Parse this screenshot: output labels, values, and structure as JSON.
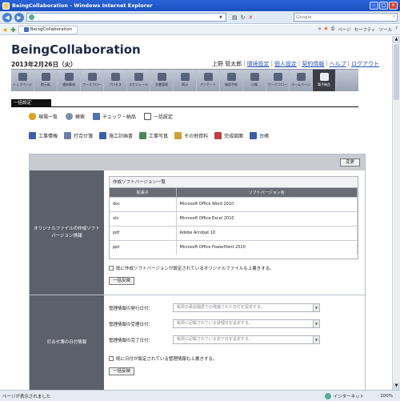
{
  "window": {
    "title": "BeingCollaboration - Windows Internet Explorer",
    "tab_title": "BeingCollaboration",
    "search_placeholder": "Google",
    "fav_tools": [
      "ページ",
      "セーフティ",
      "ツール"
    ]
  },
  "header": {
    "brand": "BeingCollaboration",
    "date": "2013年2月26日（火）",
    "user": "上野 管太郎",
    "links": [
      "環境設定",
      "個人設定",
      "契約情報",
      "ヘルプ",
      "ログアウト"
    ]
  },
  "nav": [
    {
      "label": "トップページ",
      "active": false
    },
    {
      "label": "掲示板",
      "active": false
    },
    {
      "label": "通知事項",
      "active": false
    },
    {
      "label": "ワークフロー",
      "active": false
    },
    {
      "label": "プロセス",
      "active": false
    },
    {
      "label": "スケジュール",
      "active": false
    },
    {
      "label": "文書管理",
      "active": false
    },
    {
      "label": "掲示",
      "active": false
    },
    {
      "label": "アンケート",
      "active": false
    },
    {
      "label": "施設予約",
      "active": false
    },
    {
      "label": "日報",
      "active": false
    },
    {
      "label": "ワークフロー",
      "active": false
    },
    {
      "label": "ホームページ",
      "active": false
    },
    {
      "label": "電子納品",
      "active": true
    }
  ],
  "section_title": "一括設定",
  "quick_links_row1": [
    "現場一覧",
    "検索",
    "チェック・納品",
    "一括設定"
  ],
  "quick_links_row2": [
    "工事情報",
    "打合せ簿",
    "施工計画書",
    "工事写真",
    "その他資料",
    "完成図面",
    "台帳"
  ],
  "panel": {
    "change_button": "変更",
    "section1": {
      "heading": "オリジナルファイルの作成ソフトバージョン情報",
      "table_title": "作成ソフトバージョン一覧",
      "columns": [
        "拡張子",
        "ソフトバージョン名"
      ],
      "rows": [
        [
          "doc",
          "Microsoft Office Word 2010"
        ],
        [
          "xls",
          "Microsoft Office Excel 2010"
        ],
        [
          "pdf",
          "Adobe Acrobat 10"
        ],
        [
          "ppt",
          "Microsoft Office PowerPoint 2010"
        ]
      ],
      "checkbox_label": "既に作成ソフトバージョンが設定されているオリジナルファイルも上書きする。",
      "bulk_button": "一括反映"
    },
    "section2": {
      "heading": "打合せ簿の日付情報",
      "fields": [
        {
          "label": "管理情報の発行日付：",
          "placeholder": "帳票の承認履歴での発議された日付を設定する。"
        },
        {
          "label": "管理情報の受理日付：",
          "placeholder": "帳票に記載されている受理日を設定する。"
        },
        {
          "label": "管理情報の完了日付：",
          "placeholder": "帳票に記載されている完了日を設定する。"
        }
      ],
      "checkbox_label": "既に日付が設定されている管理情報も上書きする。",
      "bulk_button": "一括反映"
    }
  },
  "status": {
    "text": "ページが表示されました",
    "zone": "インターネット",
    "zoom": "100%"
  }
}
